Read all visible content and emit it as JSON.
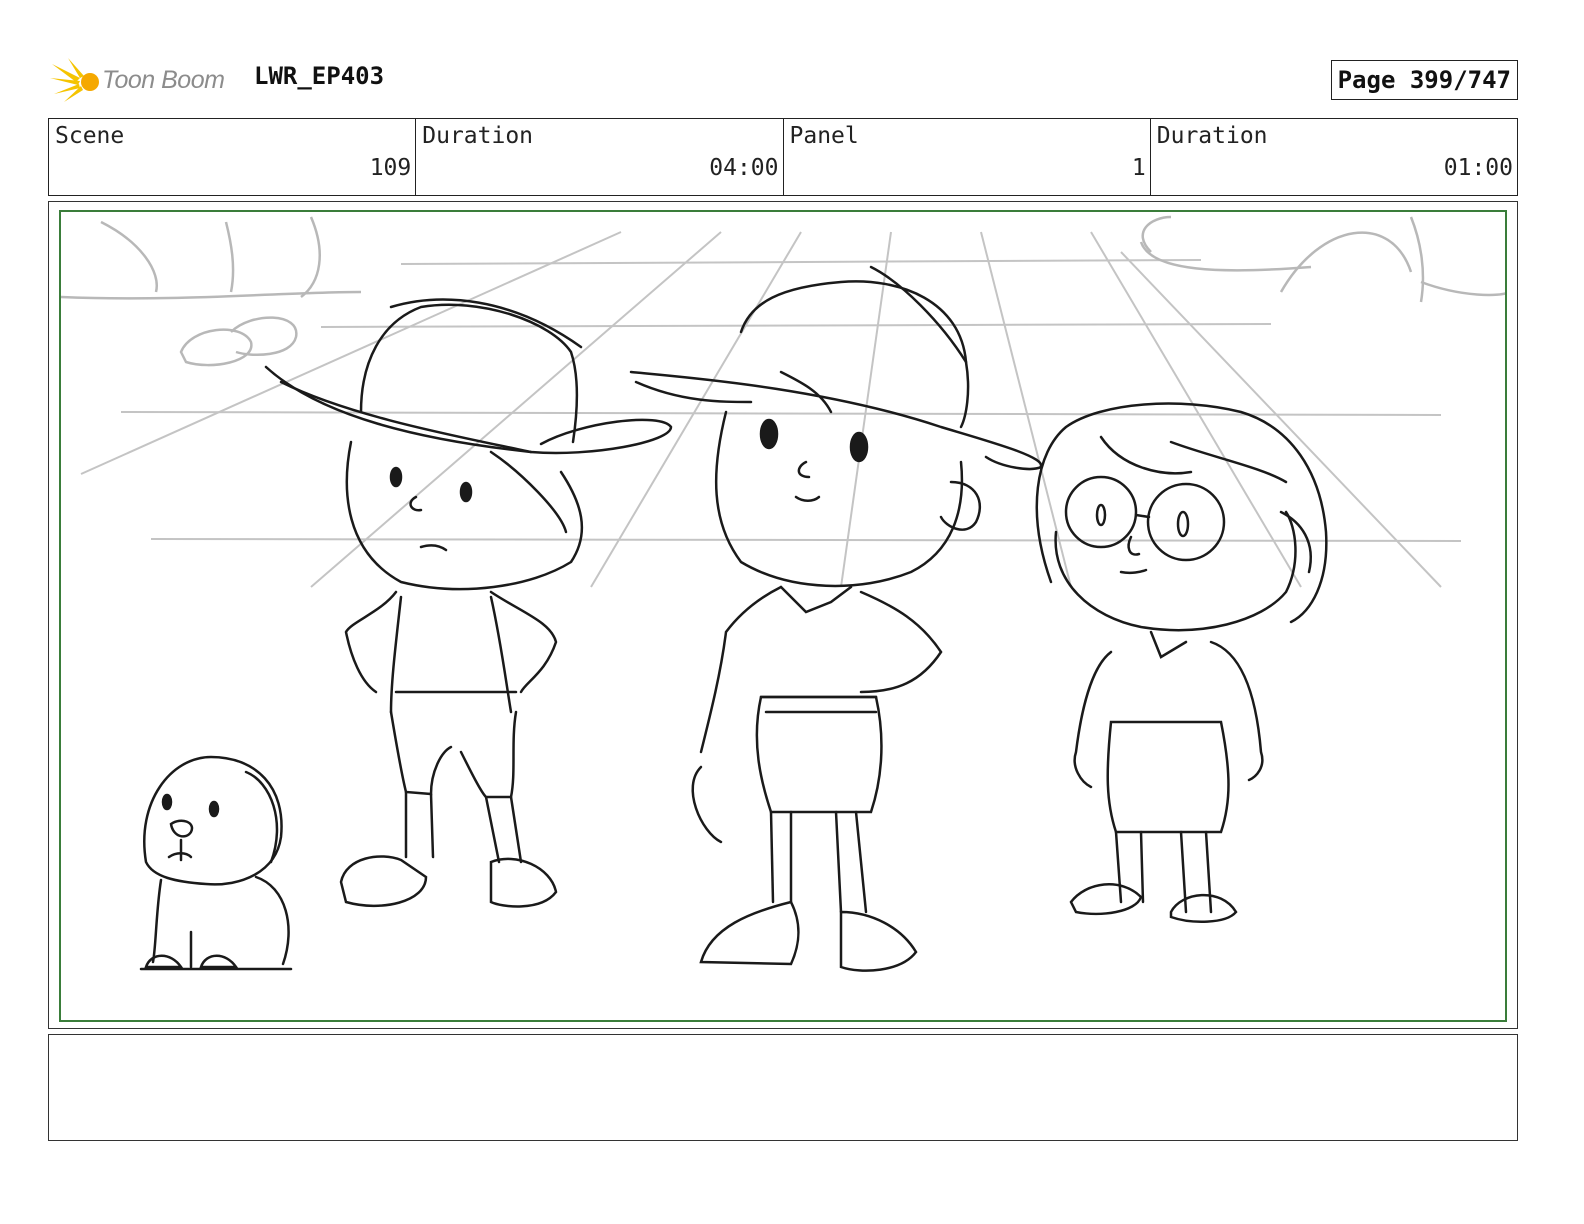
{
  "header": {
    "logo_text": "Toon Boom",
    "project": "LWR_EP403",
    "page": "Page 399/747"
  },
  "info": {
    "scene_label": "Scene",
    "scene_value": "109",
    "scene_duration_label": "Duration",
    "scene_duration_value": "04:00",
    "panel_label": "Panel",
    "panel_value": "1",
    "panel_duration_label": "Duration",
    "panel_duration_value": "01:00"
  },
  "colors": {
    "frame_border": "#3a7d3a",
    "logo_accent": "#f5c400",
    "sketch_line": "#1a1a1a",
    "background_sketch": "#bdbdbd"
  },
  "notes": {
    "text": ""
  }
}
